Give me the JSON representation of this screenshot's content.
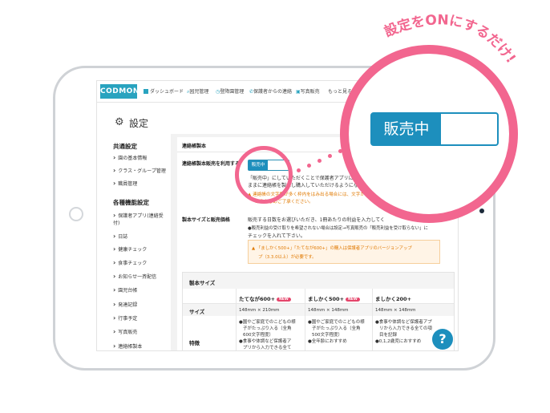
{
  "callout": {
    "text": "設定をONにするだけ!",
    "color": "#f2668f"
  },
  "header": {
    "logo": "CODMON",
    "nav": [
      "ダッシュボード",
      "园児管理",
      "登降園管理",
      "保護者からの連絡",
      "写真販売",
      "もっと見る ▾"
    ],
    "nav_icons": [
      "dashboard-icon",
      "search-icon",
      "clock-icon",
      "phone-icon",
      "photo-icon"
    ]
  },
  "settings": {
    "title": "設定"
  },
  "sidebar": {
    "section1": "共通設定",
    "items1": [
      "園の基本情報",
      "クラス・グループ管理",
      "職員管理"
    ],
    "section2": "各種機能設定",
    "items2": [
      "保護者アプリ(連絡受付)",
      "日誌",
      "健康チェック",
      "食事チェック",
      "お知らせ一斉配信",
      "園児台帳",
      "発達記録",
      "行事予定",
      "写真販売",
      "連絡帳製本"
    ]
  },
  "main": {
    "heading": "連絡帳製本",
    "option_label": "連絡帳製本販売を利用する",
    "toggle_label": "販売中",
    "desc1": "「販売中」にしていただくことで保護者アプリに「連絡帳",
    "desc2": "ままに連絡帳を製本し購入していただけるようになります",
    "warn1": "▲ 連絡帳の文字数が多く枠内をはみ出る場合には、文字が",
    "warn2": "あらかじめご了承ください。",
    "size_label": "製本サイズと販売価格",
    "size_desc1": "販売する日数をお選びいただき、1冊あたりの利益を入力してく",
    "size_desc2": "●販売利益の受け取りを希望されない場合は設定→写真販売の「販売利益を受け取らない」に",
    "size_desc3": "チェックを入れて下さい。",
    "notice": "▲ 「ましかく500+」「たてなが600+」の購入は保護者アプリのバージョンアップ",
    "notice2": "プ（3.3.0以上）が必要です。"
  },
  "table": {
    "title": "製本サイズ",
    "columns": [
      "たてなが600+",
      "ましかく500+",
      "ましかく200+"
    ],
    "new_badge": "NEW",
    "row_size_label": "サイズ",
    "sizes": [
      "148mm × 210mm",
      "148mm × 148mm",
      "148mm × 148mm"
    ],
    "row_feature_label": "特徴",
    "features": [
      [
        "●園やご家庭でのこどもの様",
        "子がたっぷり入る（全角",
        "600文字程度）",
        "●食事や体調など保護者ア",
        "プリから入力できる全て"
      ],
      [
        "●園やご家庭でのこどもの様",
        "子がたっぷり入る（全角",
        "500文字程度）",
        "●全年齢におすすめ"
      ],
      [
        "●食事や体調など保護者アプ",
        "リから入力できる全ての項",
        "目を記録",
        "●0,1,2歳児におすすめ"
      ]
    ]
  },
  "magnified": {
    "toggle_label": "販売中"
  },
  "help": {
    "label": "?"
  }
}
